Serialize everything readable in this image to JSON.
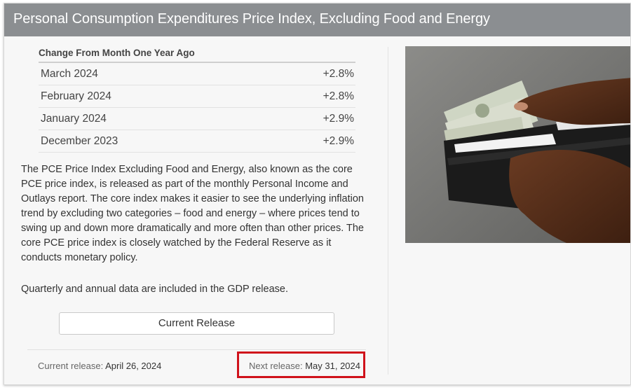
{
  "header": {
    "title": "Personal Consumption Expenditures Price Index, Excluding Food and Energy"
  },
  "table": {
    "header": "Change From Month One Year Ago",
    "rows": [
      {
        "label": "March 2024",
        "value": "+2.8%"
      },
      {
        "label": "February 2024",
        "value": "+2.8%"
      },
      {
        "label": "January 2024",
        "value": "+2.9%"
      },
      {
        "label": "December 2023",
        "value": "+2.9%"
      }
    ]
  },
  "description": "The PCE Price Index Excluding Food and Energy, also known as the core PCE price index, is released as part of the monthly Personal Income and Outlays report. The core index makes it easier to see the underlying inflation trend by excluding two categories – food and energy – where prices tend to swing up and down more dramatically and more often than other prices. The core PCE price index is closely watched by the Federal Reserve as it conducts monetary policy.",
  "note": "Quarterly and annual data are included in the GDP release.",
  "button": {
    "label": "Current Release"
  },
  "footer": {
    "current_label": "Current release:",
    "current_value": "April 26, 2024",
    "next_label": "Next release:",
    "next_value": "May 31, 2024"
  },
  "colors": {
    "header_bg": "#8b8e91",
    "highlight": "#d0121b"
  }
}
